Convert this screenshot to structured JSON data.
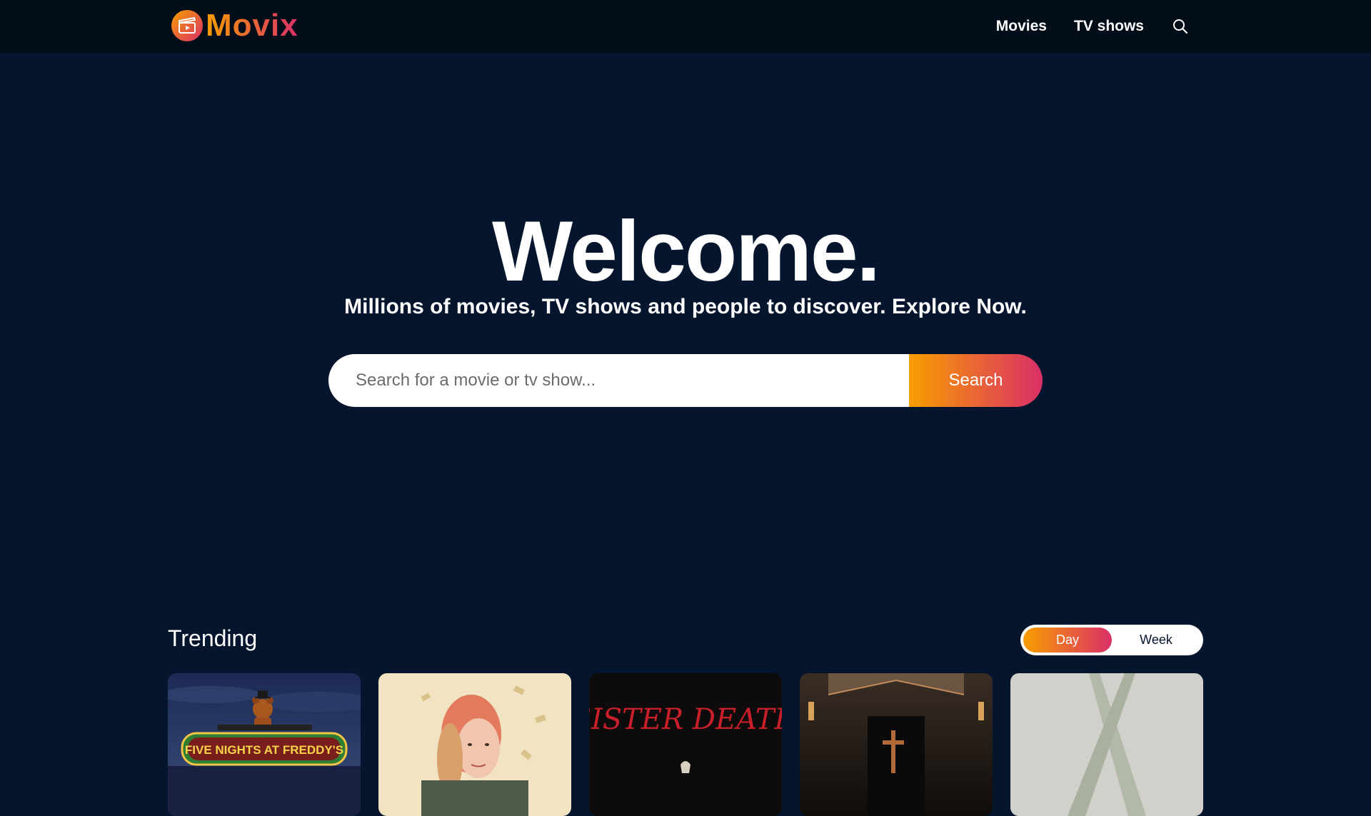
{
  "header": {
    "logo_text": "Movix",
    "nav": [
      {
        "label": "Movies"
      },
      {
        "label": "TV shows"
      }
    ]
  },
  "hero": {
    "title": "Welcome.",
    "subtitle": "Millions of movies, TV shows and people to discover. Explore Now.",
    "search_placeholder": "Search for a movie or tv show...",
    "search_button": "Search"
  },
  "trending": {
    "title": "Trending",
    "tabs": [
      {
        "label": "Day",
        "active": true
      },
      {
        "label": "Week",
        "active": false
      }
    ],
    "posters": [
      {
        "text": "FIVE NIGHTS AT FREDDY'S"
      },
      {
        "text": ""
      },
      {
        "text": "SISTER DEATH"
      },
      {
        "text": ""
      },
      {
        "text": ""
      }
    ]
  },
  "colors": {
    "background": "#04152d",
    "header": "#020d1a",
    "gradient_start": "#f89e00",
    "gradient_end": "#da2f68"
  },
  "icons": {
    "logo": "clapperboard-icon",
    "search": "search-icon"
  }
}
